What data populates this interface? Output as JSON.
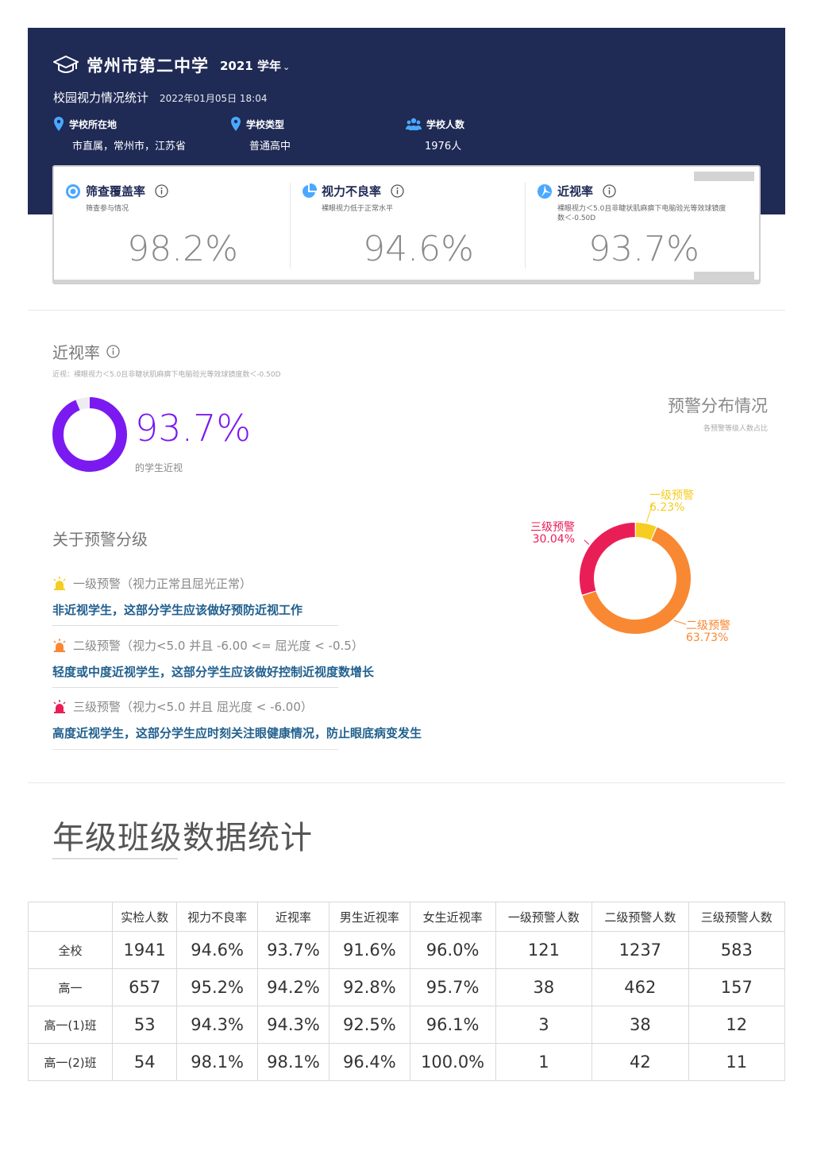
{
  "header": {
    "school_name": "常州市第二中学",
    "year": "2021 学年",
    "subtitle": "校园视力情况统计",
    "timestamp": "2022年01月05日 18:04",
    "info": [
      {
        "label": "学校所在地",
        "value": "市直属，常州市，江苏省",
        "icon": "location-pin-icon"
      },
      {
        "label": "学校类型",
        "value": "普通高中",
        "icon": "location-pin-icon"
      },
      {
        "label": "学校人数",
        "value": "1976人",
        "icon": "people-icon"
      }
    ]
  },
  "kpis": [
    {
      "title": "筛查覆盖率",
      "desc": "筛查参与情况",
      "value": "98.2%",
      "icon": "target-icon"
    },
    {
      "title": "视力不良率",
      "desc": "裸眼视力低于正常水平",
      "value": "94.6%",
      "icon": "pie-icon"
    },
    {
      "title": "近视率",
      "desc": "裸眼视力＜5.0且非睫状肌麻痹下电脑验光等效球镜度数＜-0.50D",
      "value": "93.7%",
      "icon": "aperture-icon"
    }
  ],
  "myopia": {
    "title": "近视率",
    "desc": "近视：裸眼视力＜5.0且非睫状肌麻痹下电脑验光等效球镜度数＜-0.50D",
    "percent_text": "93.7%",
    "percent_value": 0.937,
    "caption": "的学生近视",
    "color": "#7a1af0"
  },
  "distribution": {
    "title": "预警分布情况",
    "subtitle": "各预警等级人数占比",
    "chart_data": {
      "type": "pie",
      "categories": [
        "一级预警",
        "二级预警",
        "三级预警"
      ],
      "values": [
        6.23,
        63.73,
        30.04
      ],
      "labels": [
        "6.23%",
        "63.73%",
        "30.04%"
      ],
      "colors": [
        "#f6cd20",
        "#f98833",
        "#ea1e57"
      ]
    }
  },
  "warning": {
    "title": "关于预警分级",
    "items": [
      {
        "label": "一级预警（视力正常且屈光正常）",
        "desc": "非近视学生，这部分学生应该做好预防近视工作",
        "color": "#f6cd20"
      },
      {
        "label": "二级预警（视力<5.0 并且 -6.00 <= 屈光度 < -0.5）",
        "desc": "轻度或中度近视学生，这部分学生应该做好控制近视度数增长",
        "color": "#f98833"
      },
      {
        "label": "三级预警（视力<5.0 并且 屈光度 < -6.00）",
        "desc": "高度近视学生，这部分学生应时刻关注眼健康情况，防止眼底病变发生",
        "color": "#ea1e57"
      }
    ]
  },
  "grade": {
    "title": "年级班级数据统计",
    "columns": [
      "",
      "实检人数",
      "视力不良率",
      "近视率",
      "男生近视率",
      "女生近视率",
      "一级预警人数",
      "二级预警人数",
      "三级预警人数"
    ],
    "rows": [
      [
        "全校",
        "1941",
        "94.6%",
        "93.7%",
        "91.6%",
        "96.0%",
        "121",
        "1237",
        "583"
      ],
      [
        "高一",
        "657",
        "95.2%",
        "94.2%",
        "92.8%",
        "95.7%",
        "38",
        "462",
        "157"
      ],
      [
        "高一(1)班",
        "53",
        "94.3%",
        "94.3%",
        "92.5%",
        "96.1%",
        "3",
        "38",
        "12"
      ],
      [
        "高一(2)班",
        "54",
        "98.1%",
        "98.1%",
        "96.4%",
        "100.0%",
        "1",
        "42",
        "11"
      ]
    ]
  }
}
